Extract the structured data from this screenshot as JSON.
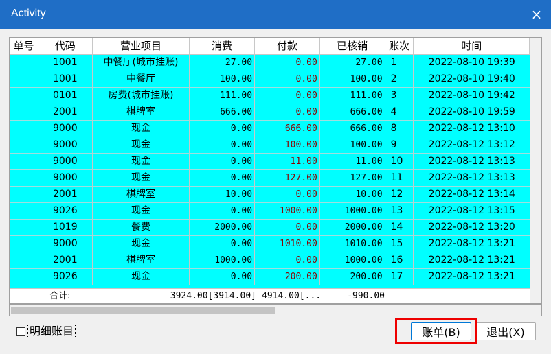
{
  "window": {
    "title": "Activity",
    "close_icon": "×"
  },
  "table": {
    "columns": [
      "单号",
      "代码",
      "营业项目",
      "消费",
      "付款",
      "已核销",
      "账次",
      "时间"
    ],
    "rows": [
      [
        "",
        "1001",
        "中餐厅(城市挂账)",
        "27.00",
        "0.00",
        "27.00",
        "1",
        "2022-08-10 19:39"
      ],
      [
        "",
        "1001",
        "中餐厅",
        "100.00",
        "0.00",
        "100.00",
        "2",
        "2022-08-10 19:40"
      ],
      [
        "",
        "0101",
        "房费(城市挂账)",
        "111.00",
        "0.00",
        "111.00",
        "3",
        "2022-08-10 19:42"
      ],
      [
        "",
        "2001",
        "棋牌室",
        "666.00",
        "0.00",
        "666.00",
        "4",
        "2022-08-10 19:59"
      ],
      [
        "",
        "9000",
        "现金",
        "0.00",
        "666.00",
        "666.00",
        "8",
        "2022-08-12 13:10"
      ],
      [
        "",
        "9000",
        "现金",
        "0.00",
        "100.00",
        "100.00",
        "9",
        "2022-08-12 13:12"
      ],
      [
        "",
        "9000",
        "现金",
        "0.00",
        "11.00",
        "11.00",
        "10",
        "2022-08-12 13:13"
      ],
      [
        "",
        "9000",
        "现金",
        "0.00",
        "127.00",
        "127.00",
        "11",
        "2022-08-12 13:13"
      ],
      [
        "",
        "2001",
        "棋牌室",
        "10.00",
        "0.00",
        "10.00",
        "12",
        "2022-08-12 13:14"
      ],
      [
        "",
        "9026",
        "现金",
        "0.00",
        "1000.00",
        "1000.00",
        "13",
        "2022-08-12 13:15"
      ],
      [
        "",
        "1019",
        "餐费",
        "2000.00",
        "0.00",
        "2000.00",
        "14",
        "2022-08-12 13:20"
      ],
      [
        "",
        "9000",
        "现金",
        "0.00",
        "1010.00",
        "1010.00",
        "15",
        "2022-08-12 13:21"
      ],
      [
        "",
        "2001",
        "棋牌室",
        "1000.00",
        "0.00",
        "1000.00",
        "16",
        "2022-08-12 13:21"
      ],
      [
        "",
        "9026",
        "现金",
        "0.00",
        "200.00",
        "200.00",
        "17",
        "2022-08-12 13:21"
      ]
    ],
    "total": {
      "label": "合计:",
      "consumption": "3924.00[3914.00]",
      "payment": "4914.00[...",
      "written_off": "-990.00"
    }
  },
  "footer": {
    "detail_checkbox_label": "明细账目",
    "detail_checked": false,
    "bill_button": "账单(B)",
    "exit_button": "退出(X)"
  },
  "colors": {
    "row_bg": "#00ffff",
    "titlebar": "#1f6ec6",
    "highlight": "#ee0000",
    "payment_text": "#8b0000"
  }
}
